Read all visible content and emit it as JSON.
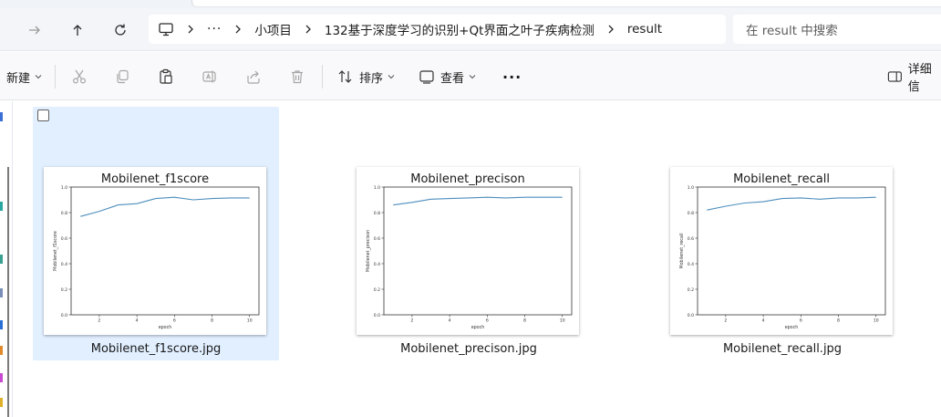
{
  "nav": {
    "breadcrumbs": [
      "小项目",
      "132基于深度学习的识别+Qt界面之叶子疾病检测",
      "result"
    ],
    "overflow": "···",
    "search_placeholder": "在 result 中搜索"
  },
  "commands": {
    "new": "新建",
    "sort": "排序",
    "view": "查看",
    "more": "···",
    "details": "详细信"
  },
  "files": [
    {
      "name": "Mobilenet_f1score.jpg",
      "selected": true,
      "chart_data": {
        "type": "line",
        "title": "Mobilenet_f1score",
        "xlabel": "epoch",
        "ylabel": "Mobilenet_f1score",
        "x": [
          1,
          2,
          3,
          4,
          5,
          6,
          7,
          8,
          9,
          10
        ],
        "values": [
          0.77,
          0.81,
          0.86,
          0.87,
          0.91,
          0.92,
          0.9,
          0.91,
          0.915,
          0.915
        ],
        "xticks": [
          "2",
          "4",
          "6",
          "8",
          "10"
        ],
        "yticks": [
          "0.0",
          "0.2",
          "0.4",
          "0.6",
          "0.8",
          "1.0"
        ],
        "xlim": [
          0.5,
          10.5
        ],
        "ylim": [
          0,
          1.0
        ],
        "color": "#4d8ebd"
      }
    },
    {
      "name": "Mobilenet_precison.jpg",
      "selected": false,
      "chart_data": {
        "type": "line",
        "title": "Mobilenet_precison",
        "xlabel": "epoch",
        "ylabel": "Mobilenet_precison",
        "x": [
          1,
          2,
          3,
          4,
          5,
          6,
          7,
          8,
          9,
          10
        ],
        "values": [
          0.86,
          0.88,
          0.905,
          0.91,
          0.915,
          0.92,
          0.915,
          0.92,
          0.92,
          0.92
        ],
        "xticks": [
          "2",
          "4",
          "6",
          "8",
          "10"
        ],
        "yticks": [
          "0.0",
          "0.2",
          "0.4",
          "0.6",
          "0.8",
          "1.0"
        ],
        "xlim": [
          0.5,
          10.5
        ],
        "ylim": [
          0,
          1.0
        ],
        "color": "#4d8ebd"
      }
    },
    {
      "name": "Mobilenet_recall.jpg",
      "selected": false,
      "chart_data": {
        "type": "line",
        "title": "Mobilenet_recall",
        "xlabel": "epoch",
        "ylabel": "Mobilenet_recall",
        "x": [
          1,
          2,
          3,
          4,
          5,
          6,
          7,
          8,
          9,
          10
        ],
        "values": [
          0.82,
          0.85,
          0.875,
          0.885,
          0.91,
          0.915,
          0.905,
          0.915,
          0.915,
          0.92
        ],
        "xticks": [
          "2",
          "4",
          "6",
          "8",
          "10"
        ],
        "yticks": [
          "0.0",
          "0.2",
          "0.4",
          "0.6",
          "0.8",
          "1.0"
        ],
        "xlim": [
          0.5,
          10.5
        ],
        "ylim": [
          0,
          1.0
        ],
        "color": "#4d8ebd"
      }
    }
  ]
}
